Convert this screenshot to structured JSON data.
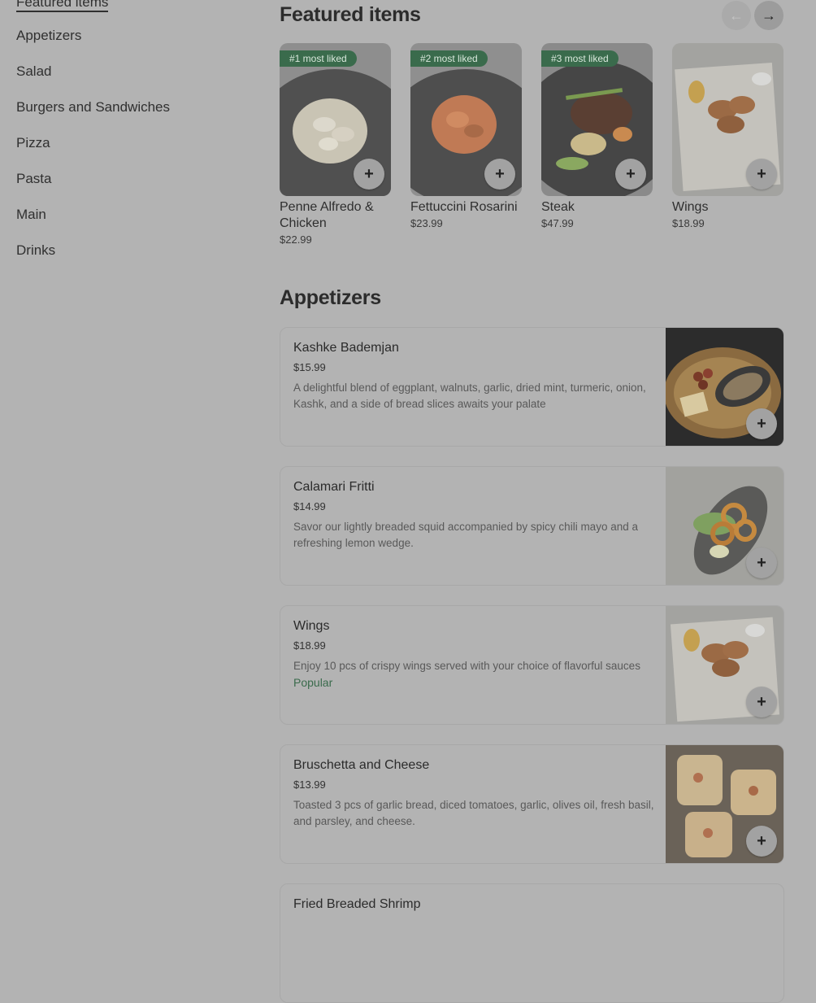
{
  "sidebar": {
    "items": [
      {
        "label": "Featured items",
        "active": true
      },
      {
        "label": "Appetizers"
      },
      {
        "label": "Salad"
      },
      {
        "label": "Burgers and Sandwiches"
      },
      {
        "label": "Pizza"
      },
      {
        "label": "Pasta"
      },
      {
        "label": "Main"
      },
      {
        "label": "Drinks"
      }
    ]
  },
  "featured": {
    "title": "Featured items",
    "prev_icon": "←",
    "next_icon": "→",
    "add_icon": "+",
    "items": [
      {
        "badge": "#1 most liked",
        "name": "Penne Alfredo & Chicken",
        "price": "$22.99"
      },
      {
        "badge": "#2 most liked",
        "name": "Fettuccini Rosarini",
        "price": "$23.99"
      },
      {
        "badge": "#3 most liked",
        "name": "Steak",
        "price": "$47.99"
      },
      {
        "badge": "",
        "name": "Wings",
        "price": "$18.99"
      }
    ]
  },
  "appetizers": {
    "title": "Appetizers",
    "items": [
      {
        "name": "Kashke Bademjan",
        "price": "$15.99",
        "description": "A delightful blend of eggplant, walnuts, garlic, dried mint, turmeric, onion, Kashk, and a side of bread slices awaits your palate",
        "tag": ""
      },
      {
        "name": "Calamari Fritti",
        "price": "$14.99",
        "description": "Savor our lightly breaded squid accompanied by spicy chili mayo and a refreshing lemon wedge.",
        "tag": ""
      },
      {
        "name": "Wings",
        "price": "$18.99",
        "description": "Enjoy 10 pcs of crispy wings served with your choice of flavorful sauces",
        "tag": "Popular"
      },
      {
        "name": "Bruschetta and Cheese",
        "price": "$13.99",
        "description": "Toasted 3 pcs of garlic bread, diced tomatoes, garlic, olives oil, fresh basil, and parsley, and cheese.",
        "tag": ""
      },
      {
        "name": "Fried Breaded Shrimp",
        "price": "",
        "description": "",
        "tag": ""
      }
    ]
  },
  "colors": {
    "overlay_bg": "#b3b3b3",
    "badge_green": "#3a6b4c",
    "tag_green": "#3a6b4c"
  }
}
